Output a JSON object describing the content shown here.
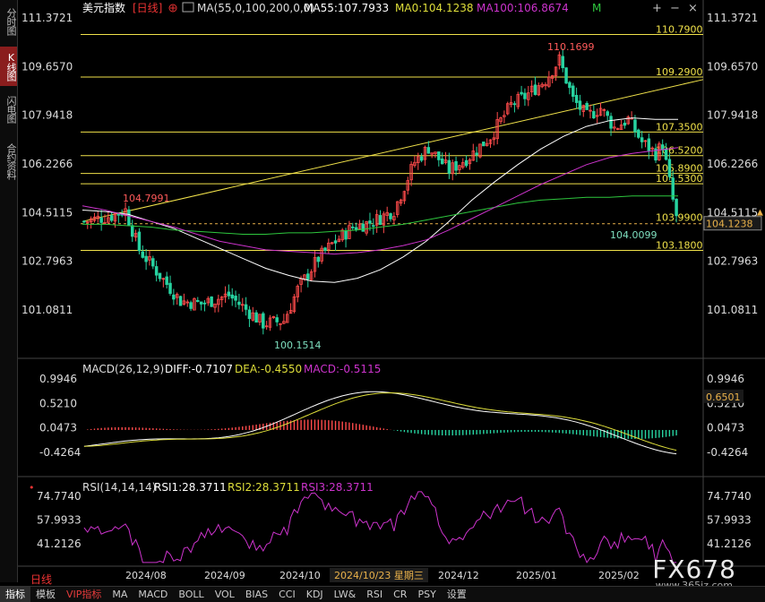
{
  "left_tabs": [
    {
      "label": "分时图",
      "active": false
    },
    {
      "label": "K线图",
      "active": true
    },
    {
      "label": "闪电图",
      "active": false
    },
    {
      "label": "合约资料",
      "active": false
    }
  ],
  "header": {
    "symbol": "美元指数",
    "period": "[日线]",
    "period_icon": "plus-circle-icon",
    "ma_label": "MA(55,0,100,200,0,0)",
    "ma55": "MA55:107.7933",
    "ma0": "MA0:104.1238",
    "ma100": "MA100:106.8674",
    "m_badge": "M"
  },
  "window_icons": [
    "add-icon",
    "minus-icon",
    "close-icon"
  ],
  "price_panel": {
    "y_ticks": [
      "111.3721",
      "109.6570",
      "107.9418",
      "106.2266",
      "104.5115",
      "102.7963",
      "101.0811"
    ],
    "current_price": "104.1238",
    "hlines": [
      {
        "value": 110.79,
        "label": "110.7900"
      },
      {
        "value": 109.29,
        "label": "109.2900"
      },
      {
        "value": 107.35,
        "label": "107.3500"
      },
      {
        "value": 106.52,
        "label": "106.5200"
      },
      {
        "value": 105.89,
        "label": "105.8900"
      },
      {
        "value": 105.53,
        "label": "105.5300"
      },
      {
        "value": 103.18,
        "label": "103.1800"
      }
    ],
    "dashed_line": {
      "value": 104.12
    },
    "label_103990": "103.9900",
    "annotations": {
      "high": "110.1699",
      "low": "100.1514",
      "early_high": "104.7991",
      "last_low": "104.0099"
    },
    "colors": {
      "up": "#ff4b4b",
      "down": "#27d3a0",
      "ma55": "#ffffff",
      "ma0": "#dede3a",
      "ma100": "#cc33cc",
      "ma200": "#2ec73e",
      "hline": "#f0e14a"
    }
  },
  "macd_panel": {
    "label": "MACD(26,12,9)",
    "diff": "DIFF:-0.7107",
    "dea": "DEA:-0.4550",
    "macd": "MACD:-0.5115",
    "y_ticks": [
      "0.9946",
      "0.5210",
      "0.0473",
      "-0.4264"
    ],
    "current_value": "0.6501"
  },
  "rsi_panel": {
    "label": "RSI(14,14,14)",
    "rsi1": "RSI1:28.3711",
    "rsi2": "RSI2:28.3711",
    "rsi3": "RSI3:28.3711",
    "y_ticks": [
      "74.7740",
      "57.9933",
      "41.2126"
    ]
  },
  "x_axis": {
    "ticks": [
      "2024/08",
      "2024/09",
      "2024/10",
      "2024/12",
      "2025/01",
      "2025/02"
    ],
    "cursor_date": "2024/10/23 星期三"
  },
  "bottom_bar": {
    "period_label": "日线",
    "items": [
      "指标",
      "模板",
      "VIP指标",
      "MA",
      "MACD",
      "BOLL",
      "VOL",
      "BIAS",
      "CCI",
      "KDJ",
      "LW&",
      "RSI",
      "CR",
      "PSY",
      "设置"
    ]
  },
  "watermark": {
    "text": "FX678",
    "sub": "www.365jz.com"
  },
  "chart_data": {
    "type": "candlestick",
    "title": "美元指数 [日线]",
    "y_range": [
      99.9,
      111.9
    ],
    "x_range": [
      "2024/07",
      "2025/02"
    ],
    "series": [
      {
        "name": "MA55",
        "values": [
          104.6,
          104.55,
          104.45,
          104.2,
          103.95,
          103.6,
          103.25,
          102.9,
          102.55,
          102.3,
          102.1,
          102.05,
          102.2,
          102.5,
          102.95,
          103.5,
          104.2,
          104.95,
          105.6,
          106.2,
          106.75,
          107.2,
          107.55,
          107.75,
          107.85,
          107.8,
          107.8
        ]
      },
      {
        "name": "MA0",
        "values": [
          104.1,
          104.1,
          104.05,
          104.0,
          103.9,
          103.85,
          103.8,
          103.75,
          103.75,
          103.8,
          103.8,
          103.85,
          103.9,
          104.0,
          104.1,
          104.25,
          104.4,
          104.55,
          104.7,
          104.85,
          104.95,
          105.0,
          105.05,
          105.05,
          105.1,
          105.1,
          105.1
        ]
      },
      {
        "name": "MA100",
        "values": [
          104.75,
          104.6,
          104.4,
          104.2,
          104.0,
          103.75,
          103.5,
          103.35,
          103.2,
          103.15,
          103.1,
          103.05,
          103.1,
          103.2,
          103.35,
          103.55,
          103.9,
          104.3,
          104.7,
          105.1,
          105.5,
          105.85,
          106.2,
          106.45,
          106.6,
          106.7,
          106.8
        ]
      }
    ],
    "candles_desc": "Daily OHLC from 2024/07 to 2025/02, low 100.1514 (late Sep 2024), high 110.1699 (mid Jan 2025), last close ~104.12"
  }
}
